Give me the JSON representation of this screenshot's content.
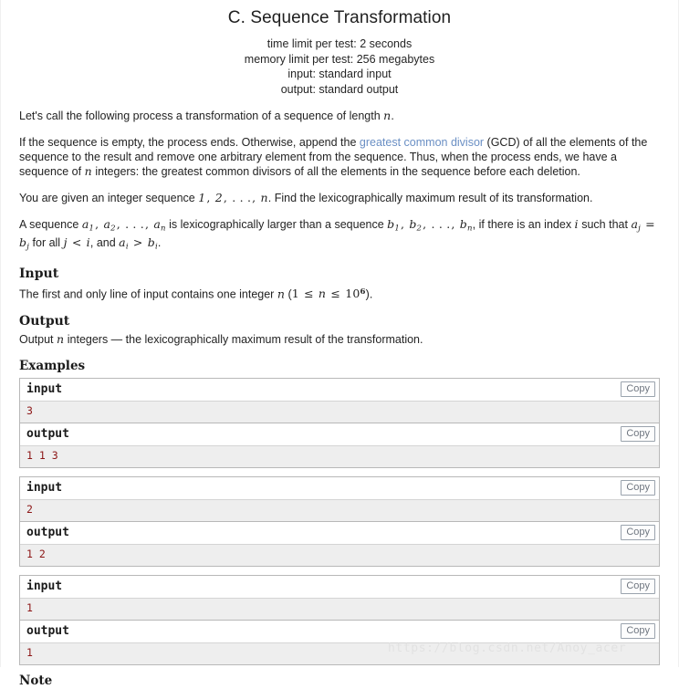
{
  "header": {
    "title": "C. Sequence Transformation",
    "time_limit": "time limit per test: 2 seconds",
    "memory_limit": "memory limit per test: 256 megabytes",
    "input_spec": "input: standard input",
    "output_spec": "output: standard output"
  },
  "statement": {
    "p1_before": "Let's call the following process a transformation of a sequence of length ",
    "p1_math": "n",
    "p1_after": ".",
    "p2_a": "If the sequence is empty, the process ends. Otherwise, append the ",
    "p2_link": "greatest common divisor",
    "p2_b": " (GCD) of all the elements of the sequence to the result and remove one arbitrary element from the sequence. Thus, when the process ends, we have a sequence of ",
    "p2_math": "n",
    "p2_c": " integers: the greatest common divisors of all the elements in the sequence before each deletion.",
    "p3_a": "You are given an integer sequence ",
    "p3_math": "1, 2, . . . , n",
    "p3_b": ". Find the lexicographically maximum result of its transformation.",
    "p4_a": "A sequence ",
    "p4_math1": "a1, a2, . . . , an",
    "p4_b": " is lexicographically larger than a sequence ",
    "p4_math2": "b1, b2, . . . , bn",
    "p4_c": ", if there is an index ",
    "p4_math3": "i",
    "p4_d": " such that ",
    "p4_math4": "aj = bj",
    "p4_e": " for all ",
    "p4_math5": "j < i",
    "p4_f": ", and ",
    "p4_math6": "ai > bi",
    "p4_g": "."
  },
  "input_section": {
    "heading": "Input",
    "text_a": "The first and only line of input contains one integer ",
    "math_n": "n",
    "text_b": " (",
    "math_range": "1 ≤ n ≤ 10^6",
    "text_c": ")."
  },
  "output_section": {
    "heading": "Output",
    "text_a": "Output ",
    "math_n": "n",
    "text_b": " integers  — the lexicographically maximum result of the transformation."
  },
  "examples": {
    "heading": "Examples",
    "copy_label": "Copy",
    "input_label": "input",
    "output_label": "output",
    "tests": [
      {
        "input": "3",
        "output": "1 1 3"
      },
      {
        "input": "2",
        "output": "1 2"
      },
      {
        "input": "1",
        "output": "1"
      }
    ]
  },
  "note": {
    "heading": "Note"
  },
  "watermark": {
    "text": "https://blog.csdn.net/Anoy_acer"
  },
  "colors": {
    "link": "#6a8fc4",
    "sample_data_text": "#8c1616",
    "sample_data_bg": "#eeeeee",
    "watermark": "#e2e2e2"
  }
}
